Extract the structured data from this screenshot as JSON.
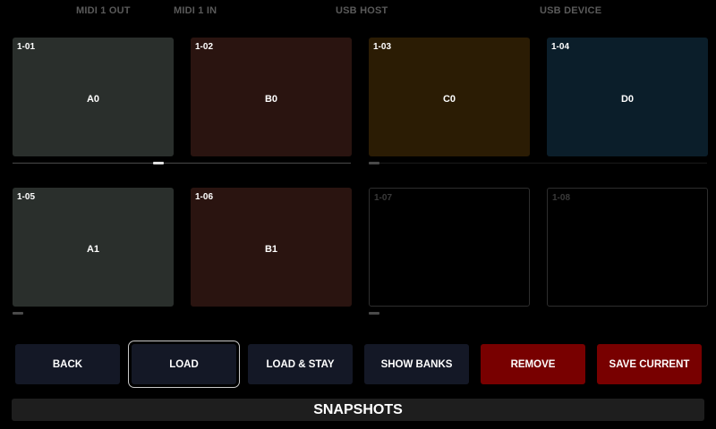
{
  "ports": {
    "midi1_out": "MIDI 1 OUT",
    "midi1_in": "MIDI 1 IN",
    "usb_host": "USB HOST",
    "usb_device": "USB DEVICE"
  },
  "snapshots": [
    {
      "num": "1-01",
      "name": "A0",
      "color": "#2a2f2c"
    },
    {
      "num": "1-02",
      "name": "B0",
      "color": "#2a1410"
    },
    {
      "num": "1-03",
      "name": "C0",
      "color": "#2b1c04"
    },
    {
      "num": "1-04",
      "name": "D0",
      "color": "#0b1e2a"
    },
    {
      "num": "1-05",
      "name": "A1",
      "color": "#2a2f2c"
    },
    {
      "num": "1-06",
      "name": "B1",
      "color": "#2a1410"
    },
    {
      "num": "1-07",
      "name": "",
      "color": ""
    },
    {
      "num": "1-08",
      "name": "",
      "color": ""
    }
  ],
  "buttons": {
    "back": "BACK",
    "load": "LOAD",
    "load_stay": "LOAD & STAY",
    "show_banks": "SHOW BANKS",
    "remove": "REMOVE",
    "save_current": "SAVE CURRENT"
  },
  "colors": {
    "button_dark": "#141826",
    "button_red": "#780000",
    "scroll_thumb_active": "#e0e0e0",
    "scroll_thumb_idle": "#4a4a4a"
  },
  "title": "SNAPSHOTS"
}
